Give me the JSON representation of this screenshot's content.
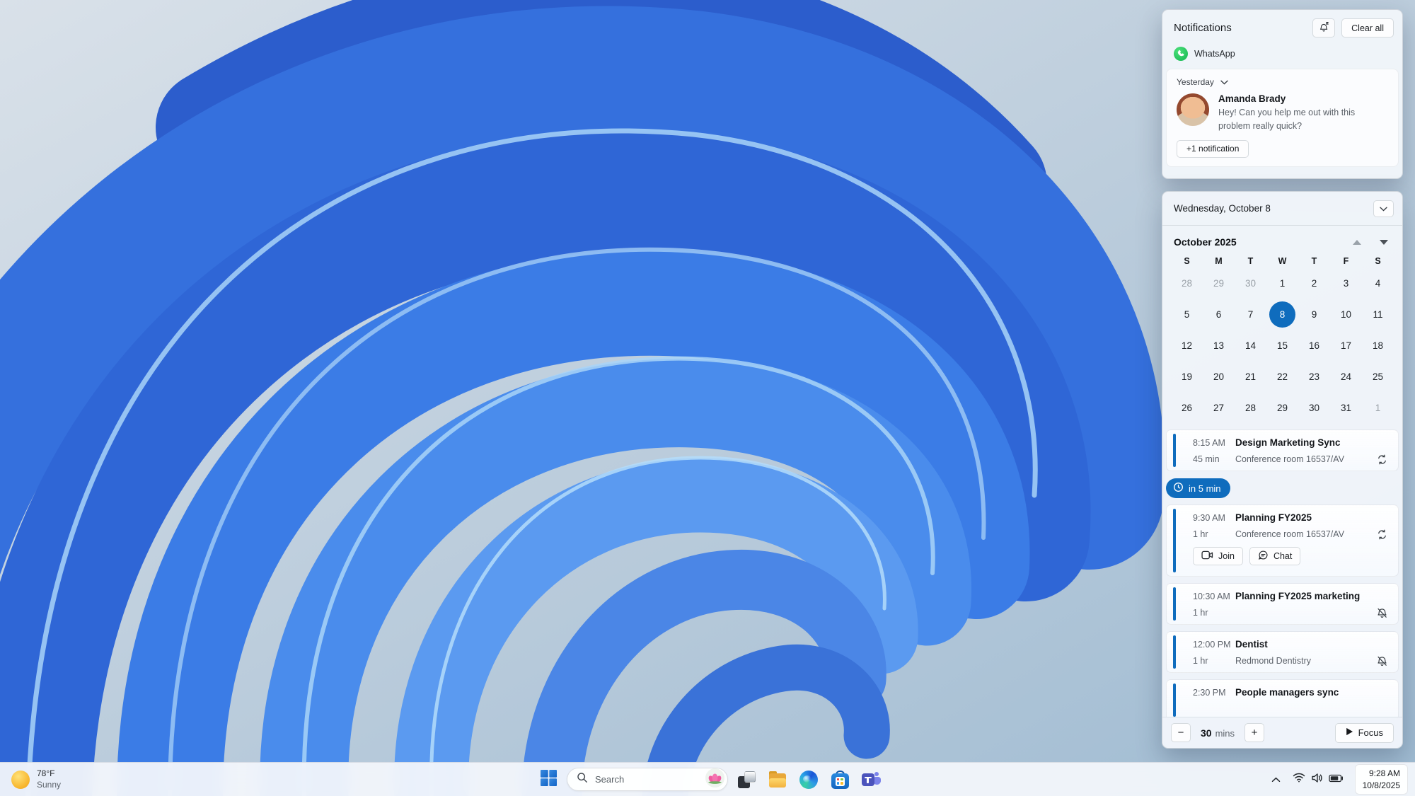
{
  "accent": "#0F6CBD",
  "notifications": {
    "title": "Notifications",
    "clear_all_label": "Clear all",
    "app_name": "WhatsApp",
    "group_time": "Yesterday",
    "sender": "Amanda Brady",
    "message": "Hey! Can you help me out with this problem really quick?",
    "more_label": "+1 notification"
  },
  "calendar": {
    "date_header": "Wednesday, October 8",
    "month_title": "October 2025",
    "weekdays": [
      "S",
      "M",
      "T",
      "W",
      "T",
      "F",
      "S"
    ],
    "weeks": [
      [
        {
          "d": "28",
          "out": true
        },
        {
          "d": "29",
          "out": true
        },
        {
          "d": "30",
          "out": true
        },
        {
          "d": "1"
        },
        {
          "d": "2"
        },
        {
          "d": "3"
        },
        {
          "d": "4"
        }
      ],
      [
        {
          "d": "5"
        },
        {
          "d": "6"
        },
        {
          "d": "7"
        },
        {
          "d": "8",
          "selected": true
        },
        {
          "d": "9"
        },
        {
          "d": "10"
        },
        {
          "d": "11"
        }
      ],
      [
        {
          "d": "12"
        },
        {
          "d": "13"
        },
        {
          "d": "14"
        },
        {
          "d": "15"
        },
        {
          "d": "16"
        },
        {
          "d": "17"
        },
        {
          "d": "18"
        }
      ],
      [
        {
          "d": "19"
        },
        {
          "d": "20"
        },
        {
          "d": "21"
        },
        {
          "d": "22"
        },
        {
          "d": "23"
        },
        {
          "d": "24"
        },
        {
          "d": "25"
        }
      ],
      [
        {
          "d": "26"
        },
        {
          "d": "27"
        },
        {
          "d": "28"
        },
        {
          "d": "29"
        },
        {
          "d": "30"
        },
        {
          "d": "31"
        },
        {
          "d": "1",
          "out": true
        }
      ]
    ]
  },
  "agenda": {
    "reminder": {
      "label": "in 5 min"
    },
    "events": [
      {
        "time": "8:15 AM",
        "title": "Design Marketing Sync",
        "duration": "45 min",
        "location": "Conference room 16537/AV",
        "icon": "recurrence"
      },
      {
        "time": "9:30 AM",
        "title": "Planning FY2025",
        "duration": "1 hr",
        "location": "Conference room 16537/AV",
        "icon": "recurrence",
        "actions": [
          {
            "name": "join",
            "label": "Join"
          },
          {
            "name": "chat",
            "label": "Chat"
          }
        ]
      },
      {
        "time": "10:30 AM",
        "title": "Planning FY2025 marketing",
        "duration": "1 hr",
        "location": "",
        "icon": "muted"
      },
      {
        "time": "12:00 PM",
        "title": "Dentist",
        "duration": "1 hr",
        "location": "Redmond Dentistry",
        "icon": "muted"
      },
      {
        "time": "2:30 PM",
        "title": "People managers sync",
        "duration": null,
        "location": null,
        "icon": null
      }
    ]
  },
  "focus": {
    "decrease": "−",
    "minutes": "30",
    "unit": "mins",
    "increase": "+",
    "button": "Focus"
  },
  "taskbar": {
    "weather_temp": "78°F",
    "weather_condition": "Sunny",
    "search_placeholder": "Search",
    "clock_time": "9:28 AM",
    "clock_date": "10/8/2025"
  }
}
